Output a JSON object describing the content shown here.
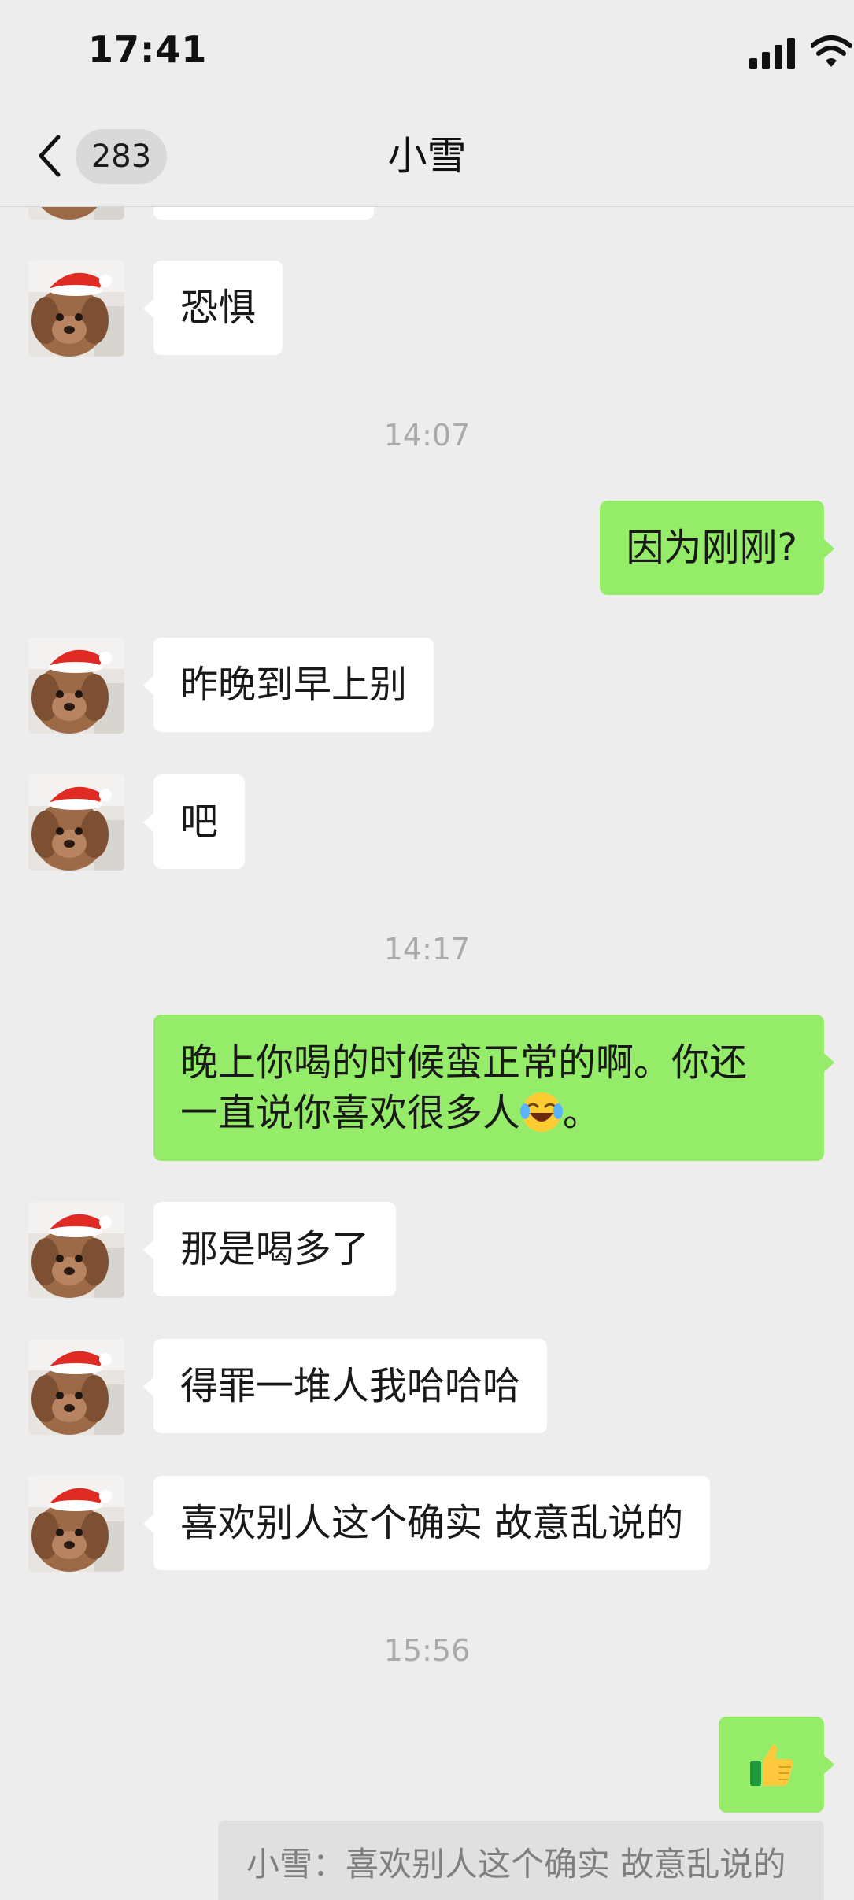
{
  "status_bar": {
    "time": "17:41"
  },
  "nav": {
    "unread_count": "283",
    "title": "小雪"
  },
  "messages": [
    {
      "sender": "contact",
      "text": "恐惧"
    },
    {
      "timestamp": "14:07"
    },
    {
      "sender": "me",
      "text": "因为刚刚?"
    },
    {
      "sender": "contact",
      "text": "昨晚到早上别"
    },
    {
      "sender": "contact",
      "text": "吧"
    },
    {
      "timestamp": "14:17"
    },
    {
      "sender": "me",
      "line1": "晚上你喝的时候蛮正常的啊。你还",
      "line2_before_emoji": "一直说你喜欢很多人",
      "emoji": "face-with-tears-of-joy-icon",
      "line2_after_emoji": "。"
    },
    {
      "sender": "contact",
      "text": "那是喝多了"
    },
    {
      "sender": "contact",
      "text": "得罪一堆人我哈哈哈"
    },
    {
      "sender": "contact",
      "text": "喜欢别人这个确实 故意乱说的"
    },
    {
      "timestamp": "15:56"
    },
    {
      "sender": "me",
      "sticker": "thumbs-up-icon"
    }
  ],
  "quote": {
    "text": "小雪：喜欢别人这个确实 故意乱说的"
  },
  "colors": {
    "background": "#ededed",
    "incoming_bubble": "#ffffff",
    "outgoing_bubble": "#95ec69",
    "timestamp_text": "#aaaaaa"
  }
}
